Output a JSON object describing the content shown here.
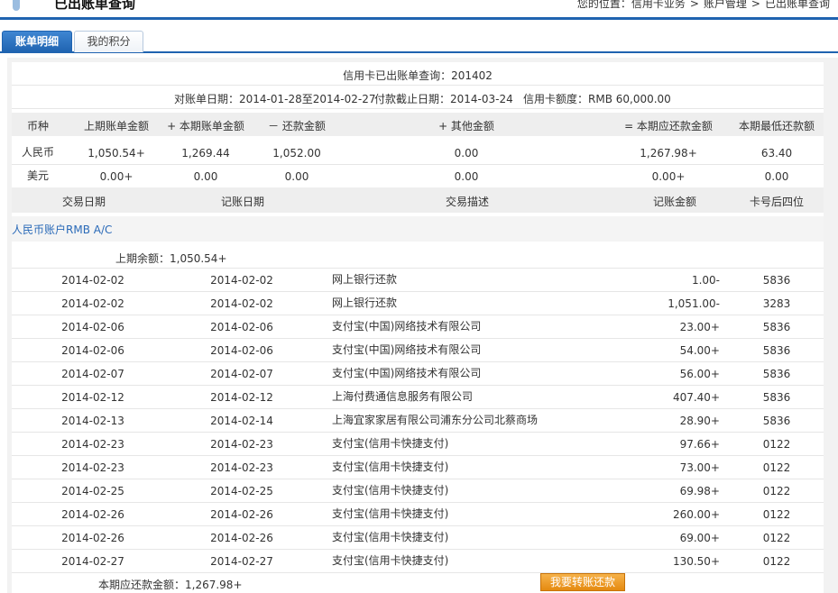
{
  "header": {
    "title": "已出账单查询",
    "breadcrumb": [
      "您的位置：",
      "信用卡业务",
      "账户管理",
      "已出账单查询"
    ]
  },
  "tabs": [
    {
      "label": "账单明细",
      "active": true
    },
    {
      "label": "我的积分",
      "active": false
    }
  ],
  "statement": {
    "title": "信用卡已出账单查询：201402",
    "cycle": "对账单日期：2014-01-28至2014-02-27",
    "due_date": "付款截止日期：2014-03-24",
    "limit": "信用卡额度：RMB 60,000.00"
  },
  "summary": {
    "headers": [
      "币种",
      "上期账单金额",
      "+ 本期账单金额",
      "－ 还款金额",
      "+ 其他金额",
      "= 本期应还款金额",
      "本期最低还款额"
    ],
    "rows": [
      [
        "人民币",
        "1,050.54+",
        "1,269.44",
        "1,052.00",
        "0.00",
        "1,267.98+",
        "63.40"
      ],
      [
        "美元",
        "0.00+",
        "0.00",
        "0.00",
        "0.00",
        "0.00+",
        "0.00"
      ]
    ]
  },
  "transactions": {
    "headers": [
      "交易日期",
      "记账日期",
      "交易描述",
      "记账金额",
      "卡号后四位"
    ],
    "account_label": "人民币账户RMB A/C",
    "opening_balance": "上期余额：1,050.54+",
    "rows": [
      [
        "2014-02-02",
        "2014-02-02",
        "网上银行还款",
        "1.00-",
        "5836"
      ],
      [
        "2014-02-02",
        "2014-02-02",
        "网上银行还款",
        "1,051.00-",
        "3283"
      ],
      [
        "2014-02-06",
        "2014-02-06",
        "支付宝(中国)网络技术有限公司",
        "23.00+",
        "5836"
      ],
      [
        "2014-02-06",
        "2014-02-06",
        "支付宝(中国)网络技术有限公司",
        "54.00+",
        "5836"
      ],
      [
        "2014-02-07",
        "2014-02-07",
        "支付宝(中国)网络技术有限公司",
        "56.00+",
        "5836"
      ],
      [
        "2014-02-12",
        "2014-02-12",
        "上海付费通信息服务有限公司",
        "407.40+",
        "5836"
      ],
      [
        "2014-02-13",
        "2014-02-14",
        "上海宜家家居有限公司浦东分公司北蔡商场",
        "28.90+",
        "5836"
      ],
      [
        "2014-02-23",
        "2014-02-23",
        "支付宝(信用卡快捷支付)",
        "97.66+",
        "0122"
      ],
      [
        "2014-02-23",
        "2014-02-23",
        "支付宝(信用卡快捷支付)",
        "73.00+",
        "0122"
      ],
      [
        "2014-02-25",
        "2014-02-25",
        "支付宝(信用卡快捷支付)",
        "69.98+",
        "0122"
      ],
      [
        "2014-02-26",
        "2014-02-26",
        "支付宝(信用卡快捷支付)",
        "260.00+",
        "0122"
      ],
      [
        "2014-02-26",
        "2014-02-26",
        "支付宝(信用卡快捷支付)",
        "69.00+",
        "0122"
      ],
      [
        "2014-02-27",
        "2014-02-27",
        "支付宝(信用卡快捷支付)",
        "130.50+",
        "0122"
      ]
    ],
    "total": "本期应还款金额：1,267.98+"
  },
  "actions": {
    "transfer_label": "我要转账还款"
  },
  "colors": {
    "brand": "#1f63b0",
    "button": "#e58a10",
    "account_label": "#2a6ab8"
  }
}
